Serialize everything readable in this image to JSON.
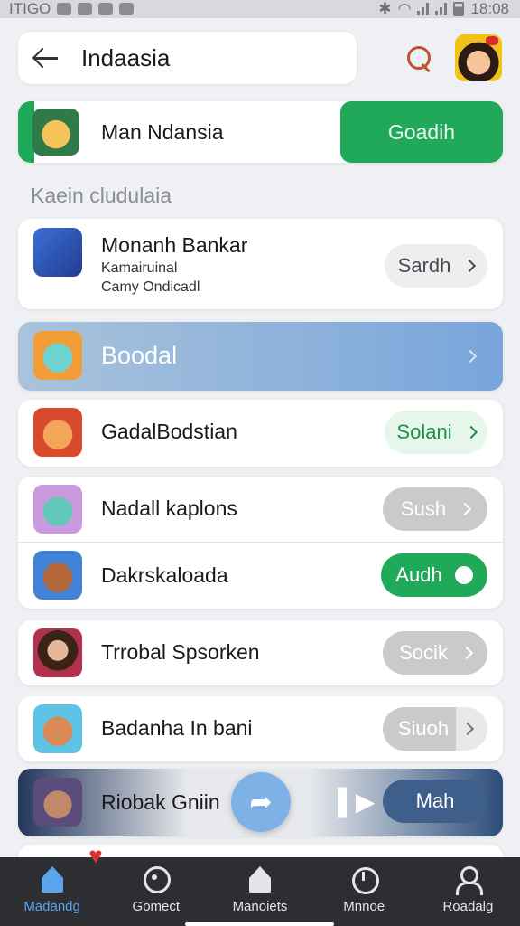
{
  "status_bar": {
    "left_text": "ITIGO",
    "time": "18:08"
  },
  "header": {
    "search_text": "Indaasia"
  },
  "promo": {
    "title": "Man Ndansia",
    "button": "Goadih"
  },
  "section": {
    "label": "Kaein cludulaia"
  },
  "rows": [
    {
      "title": "Monanh Bankar",
      "sub1": "Kamairuinal",
      "sub2": "Camy Ondicadl",
      "button": "Sardh"
    },
    {
      "title": "Boodal"
    },
    {
      "title": "GadalBodstian",
      "button": "Solani"
    },
    {
      "title": "Nadall kaplons",
      "button": "Sush"
    },
    {
      "title": "Dakrskaloada",
      "button": "Audh"
    },
    {
      "title": "Trrobal Spsorken",
      "button": "Socik"
    },
    {
      "title": "Badanha In bani",
      "button": "Siuoh"
    },
    {
      "title": "Riobak Gniin",
      "button": "Mah"
    }
  ],
  "nav": [
    {
      "label": "Madandg"
    },
    {
      "label": "Gomect"
    },
    {
      "label": "Manoiets"
    },
    {
      "label": "Mnnoe"
    },
    {
      "label": "Roadalg"
    }
  ],
  "colors": {
    "accent_green": "#21a95a",
    "accent_blue": "#5aa4ee",
    "nav_bg": "#2d2e31"
  }
}
